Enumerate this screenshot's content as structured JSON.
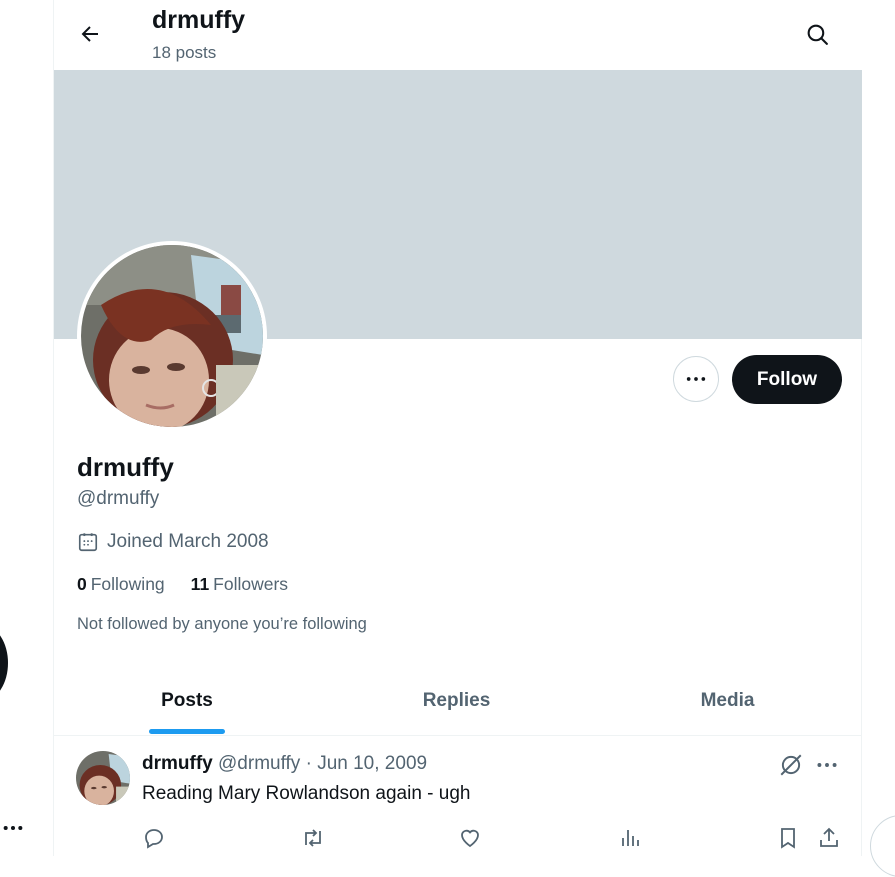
{
  "header": {
    "title": "drmuffy",
    "post_count": "18 posts"
  },
  "profile": {
    "display_name": "drmuffy",
    "handle": "@drmuffy",
    "joined": "Joined March 2008",
    "following_count": "0",
    "following_label": "Following",
    "followers_count": "11",
    "followers_label": "Followers",
    "not_followed": "Not followed by anyone you’re following",
    "follow_label": "Follow"
  },
  "tabs": [
    {
      "label": "Posts",
      "active": true
    },
    {
      "label": "Replies",
      "active": false
    },
    {
      "label": "Media",
      "active": false
    }
  ],
  "post": {
    "name": "drmuffy",
    "handle": "@drmuffy",
    "separator": "·",
    "date": "Jun 10, 2009",
    "text": "Reading Mary Rowlandson again - ugh"
  },
  "colors": {
    "accent": "#1d9bf0",
    "banner": "#cfd9de",
    "text": "#0f1419",
    "muted": "#536471"
  },
  "icons": [
    "back-arrow-icon",
    "search-icon",
    "more-icon",
    "calendar-icon",
    "grok-icon",
    "reply-icon",
    "repost-icon",
    "like-icon",
    "views-icon",
    "bookmark-icon",
    "share-icon"
  ]
}
